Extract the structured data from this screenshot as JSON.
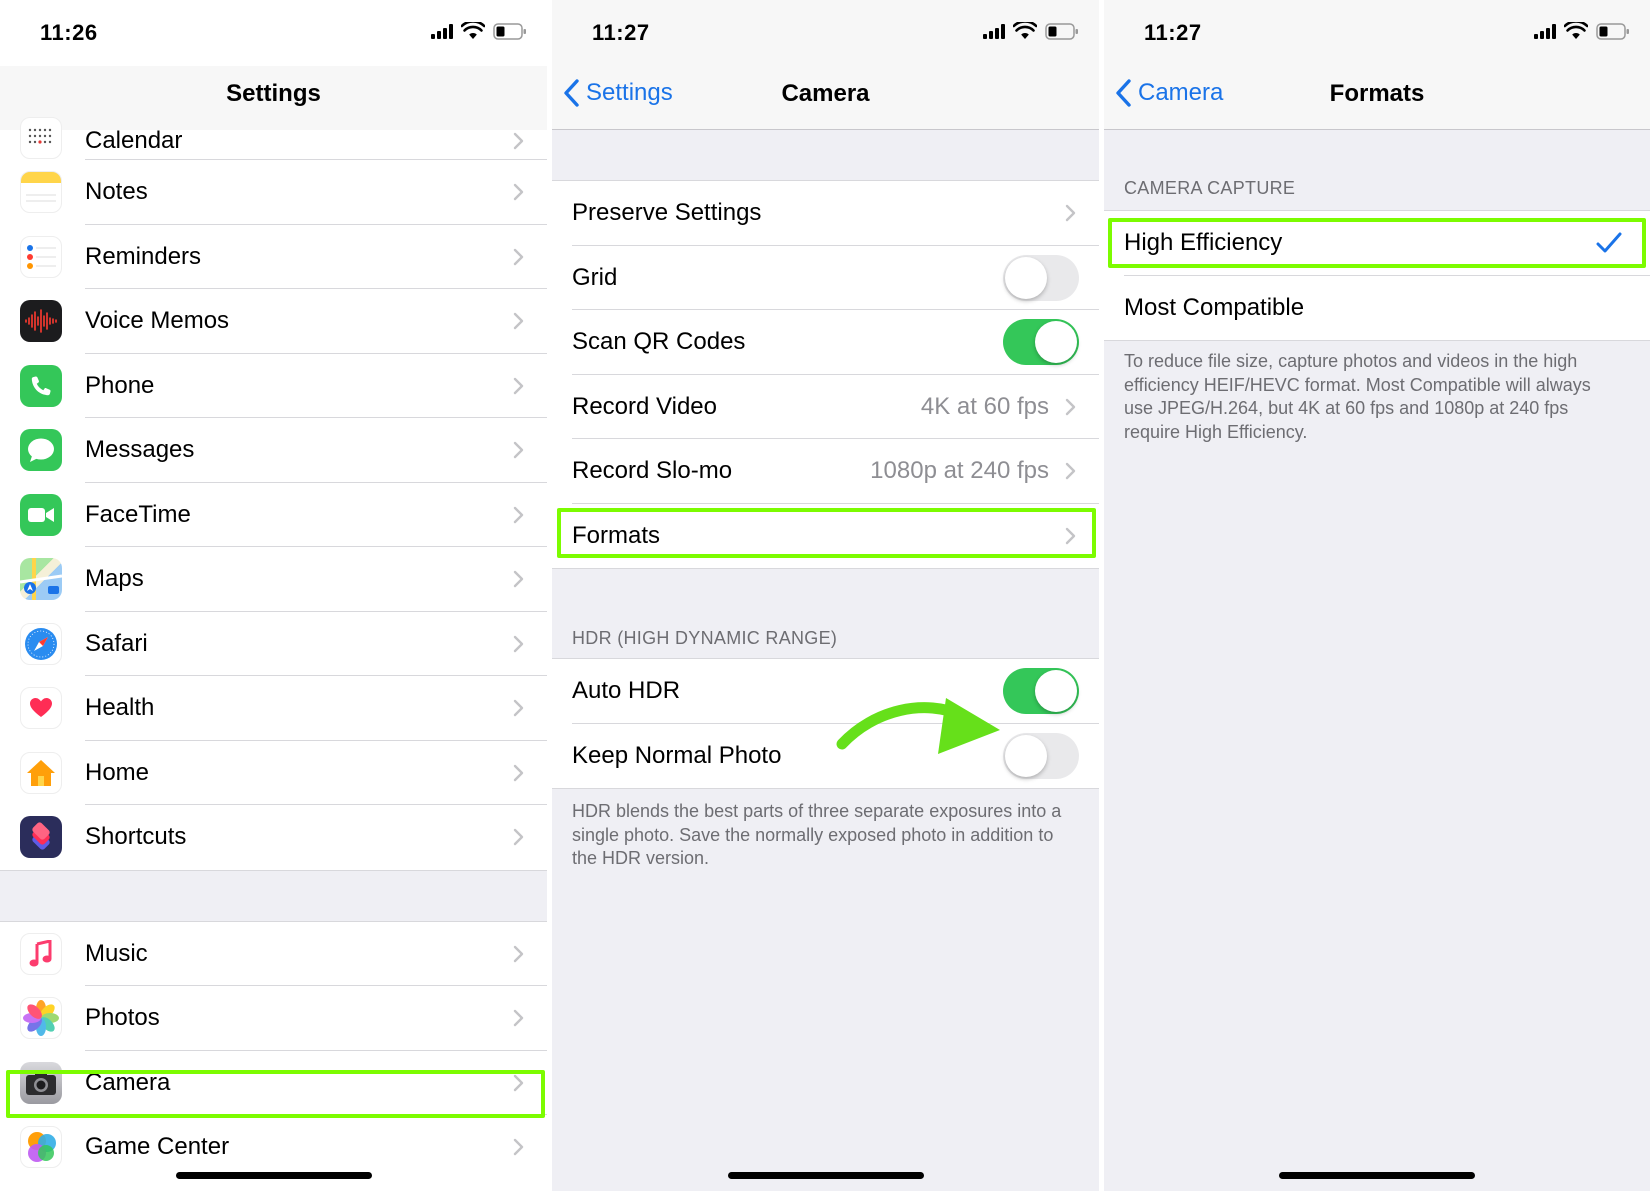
{
  "colors": {
    "accent": "#1a73e8",
    "toggle_on": "#34c759",
    "highlight": "#7cfc00"
  },
  "settings_screen": {
    "time": "11:26",
    "title": "Settings",
    "items_top": [
      {
        "label": "Calendar",
        "icon": "calendar-icon"
      },
      {
        "label": "Notes",
        "icon": "notes-icon"
      },
      {
        "label": "Reminders",
        "icon": "reminders-icon"
      },
      {
        "label": "Voice Memos",
        "icon": "voice-memos-icon"
      },
      {
        "label": "Phone",
        "icon": "phone-icon"
      },
      {
        "label": "Messages",
        "icon": "messages-icon"
      },
      {
        "label": "FaceTime",
        "icon": "facetime-icon"
      },
      {
        "label": "Maps",
        "icon": "maps-icon"
      },
      {
        "label": "Safari",
        "icon": "safari-icon"
      },
      {
        "label": "Health",
        "icon": "health-icon"
      },
      {
        "label": "Home",
        "icon": "home-icon"
      },
      {
        "label": "Shortcuts",
        "icon": "shortcuts-icon"
      }
    ],
    "items_bottom": [
      {
        "label": "Music",
        "icon": "music-icon"
      },
      {
        "label": "Photos",
        "icon": "photos-icon"
      },
      {
        "label": "Camera",
        "icon": "camera-icon"
      },
      {
        "label": "Game Center",
        "icon": "game-center-icon"
      }
    ]
  },
  "camera_screen": {
    "time": "11:27",
    "back_label": "Settings",
    "title": "Camera",
    "rows": {
      "preserve": "Preserve Settings",
      "grid": "Grid",
      "scan_qr": "Scan QR Codes",
      "record_video": "Record Video",
      "record_video_value": "4K at 60 fps",
      "record_slomo": "Record Slo-mo",
      "record_slomo_value": "1080p at 240 fps",
      "formats": "Formats"
    },
    "hdr_header": "HDR (HIGH DYNAMIC RANGE)",
    "auto_hdr": "Auto HDR",
    "keep_normal": "Keep Normal Photo",
    "hdr_footer": "HDR blends the best parts of three separate exposures into a single photo. Save the normally exposed photo in addition to the HDR version.",
    "toggles": {
      "grid": false,
      "scan_qr": true,
      "auto_hdr": true,
      "keep_normal": false
    }
  },
  "formats_screen": {
    "time": "11:27",
    "back_label": "Camera",
    "title": "Formats",
    "header": "CAMERA CAPTURE",
    "options": [
      "High Efficiency",
      "Most Compatible"
    ],
    "selected": "High Efficiency",
    "footer": "To reduce file size, capture photos and videos in the high efficiency HEIF/HEVC format. Most Compatible will always use JPEG/H.264, but 4K at 60 fps and 1080p at 240 fps require High Efficiency."
  }
}
